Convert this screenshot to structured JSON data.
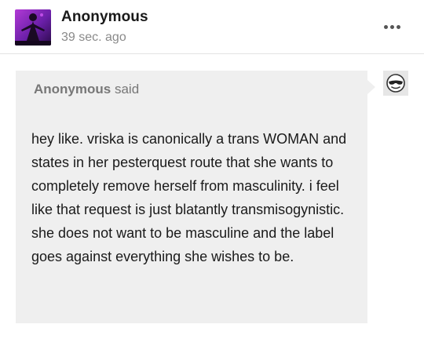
{
  "post": {
    "author": "Anonymous",
    "timestamp": "39 sec. ago",
    "avatar_icon": "silhouette-figure-avatar",
    "more_icon": "more-horizontal-icon"
  },
  "ask": {
    "asker_name": "Anonymous",
    "said_label": "said",
    "question": "hey like. vriska is canonically a trans WOMAN and states in her pesterquest route that she wants to completely remove herself from masculinity. i feel like that request is just blatantly transmisogynistic. she does not want to be masculine and the label goes against everything she wishes to be.",
    "asker_avatar_icon": "anonymous-sunglasses-avatar",
    "bubble_color": "#efefef"
  }
}
